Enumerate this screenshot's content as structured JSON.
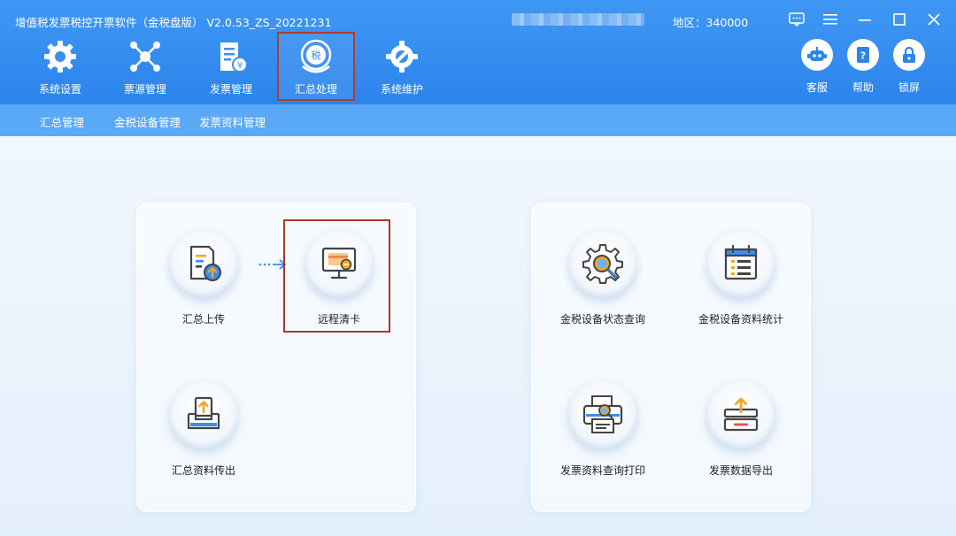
{
  "window": {
    "title": "增值税发票税控开票软件（金税盘版） V2.0.53_ZS_20221231",
    "region": "地区：340000"
  },
  "main_nav": [
    {
      "label": "系统设置",
      "icon": "gear-icon"
    },
    {
      "label": "票源管理",
      "icon": "network-icon"
    },
    {
      "label": "发票管理",
      "icon": "invoice-icon"
    },
    {
      "label": "汇总处理",
      "icon": "tax-summary-icon",
      "active": true
    },
    {
      "label": "系统维护",
      "icon": "wrench-gear-icon"
    }
  ],
  "tools": [
    {
      "label": "客服",
      "icon": "robot-icon"
    },
    {
      "label": "帮助",
      "icon": "help-book-icon"
    },
    {
      "label": "锁屏",
      "icon": "lock-icon"
    }
  ],
  "sub_nav": [
    "汇总管理",
    "金税设备管理",
    "发票资料管理"
  ],
  "left_panel": {
    "items": [
      {
        "label": "汇总上传",
        "icon": "summary-upload-icon"
      },
      {
        "label": "远程清卡",
        "icon": "remote-clear-card-icon"
      },
      {
        "label": "汇总资料传出",
        "icon": "summary-data-export-icon"
      }
    ]
  },
  "right_panel": {
    "items": [
      {
        "label": "金税设备状态查询",
        "icon": "device-status-query-icon"
      },
      {
        "label": "金税设备资料统计",
        "icon": "device-data-stats-icon"
      },
      {
        "label": "发票资料查询打印",
        "icon": "invoice-print-icon"
      },
      {
        "label": "发票数据导出",
        "icon": "invoice-export-icon"
      }
    ]
  },
  "colors": {
    "header_blue": "#2c84ec",
    "subbar_blue": "#5aa9f6",
    "highlight_red": "#a8392a",
    "icon_orange": "#f5a623",
    "icon_blue": "#3b8ef0"
  }
}
